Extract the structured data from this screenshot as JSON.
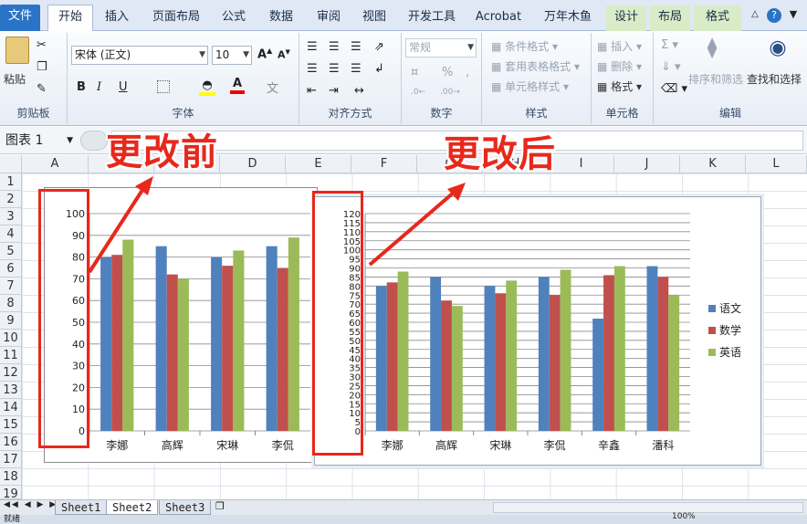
{
  "tabs": [
    "文件",
    "开始",
    "插入",
    "页面布局",
    "公式",
    "数据",
    "审阅",
    "视图",
    "开发工具",
    "Acrobat",
    "万年木鱼",
    "设计",
    "布局",
    "格式"
  ],
  "ribbon": {
    "paste_label": "粘贴",
    "font_name": "宋体 (正文)",
    "font_size": "10",
    "group_clipboard": "剪贴板",
    "group_font": "字体",
    "group_align": "对齐方式",
    "group_number": "数字",
    "group_styles": "样式",
    "group_cells": "单元格",
    "group_edit": "编辑",
    "number_format": "常规",
    "cond_format": "条件格式",
    "table_format": "套用表格格式",
    "cell_style": "单元格样式",
    "insert": "插入",
    "delete": "删除",
    "format": "格式",
    "sort_filter": "排序和筛选",
    "find_select": "查找和选择",
    "bold": "B",
    "italic": "I",
    "underline": "U",
    "wen": "文"
  },
  "name_box": "图表 1",
  "columns": [
    "A",
    "B",
    "C",
    "D",
    "E",
    "F",
    "G",
    "H",
    "I",
    "J",
    "K",
    "L"
  ],
  "rows": [
    "1",
    "2",
    "3",
    "4",
    "5",
    "6",
    "7",
    "8",
    "9",
    "10",
    "11",
    "12",
    "13",
    "14",
    "15",
    "16",
    "17",
    "18",
    "19"
  ],
  "annotations": {
    "before": "更改前",
    "after": "更改后"
  },
  "sheets": [
    "Sheet1",
    "Sheet2",
    "Sheet3"
  ],
  "status": {
    "mode": "就绪",
    "zoom": "100%"
  },
  "colors": {
    "语文": "#4f81bd",
    "数学": "#c0504d",
    "英语": "#9bbb59",
    "annotation": "#e8281b"
  },
  "chart_data": [
    {
      "type": "bar",
      "categories": [
        "李娜",
        "高辉",
        "宋琳",
        "李侃"
      ],
      "series": [
        {
          "name": "语文",
          "values": [
            80,
            85,
            80,
            85
          ]
        },
        {
          "name": "数学",
          "values": [
            81,
            72,
            76,
            75
          ]
        },
        {
          "name": "英语",
          "values": [
            88,
            70,
            83,
            89
          ]
        }
      ],
      "ylim": [
        0,
        100
      ],
      "yticks": [
        0,
        10,
        20,
        30,
        40,
        50,
        60,
        70,
        80,
        90,
        100
      ],
      "grid": true
    },
    {
      "type": "bar",
      "categories": [
        "李娜",
        "高辉",
        "宋琳",
        "李侃",
        "辛鑫",
        "潘科"
      ],
      "series": [
        {
          "name": "语文",
          "values": [
            80,
            85,
            80,
            85,
            62,
            91
          ]
        },
        {
          "name": "数学",
          "values": [
            82,
            72,
            76,
            75,
            86,
            85
          ]
        },
        {
          "name": "英语",
          "values": [
            88,
            69,
            83,
            89,
            91,
            75
          ]
        }
      ],
      "ylim": [
        0,
        120
      ],
      "yticks": [
        0,
        5,
        10,
        15,
        20,
        25,
        30,
        35,
        40,
        45,
        50,
        55,
        60,
        65,
        70,
        75,
        80,
        85,
        90,
        95,
        100,
        105,
        110,
        115,
        120
      ],
      "grid": true,
      "legend": "right"
    }
  ]
}
